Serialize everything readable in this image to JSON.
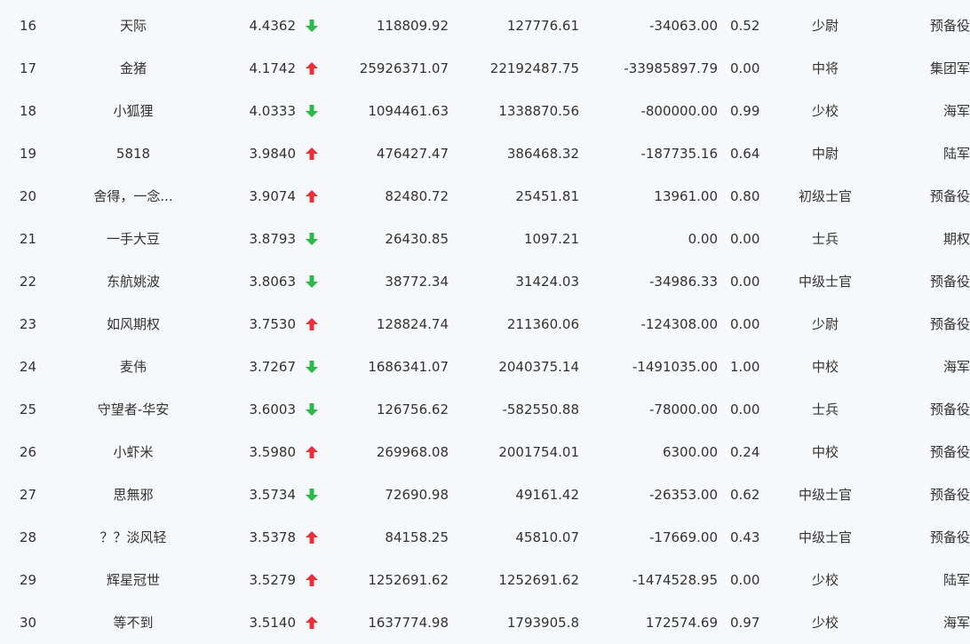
{
  "colors": {
    "up": "#e8303a",
    "down": "#2db84d",
    "text": "#333333",
    "background": "#f7f8fa"
  },
  "rows": [
    {
      "rank": "16",
      "name": "天际",
      "score": "4.4362",
      "trend": "down",
      "v1": "118809.92",
      "v2": "127776.61",
      "v3": "-34063.00",
      "ratio": "0.52",
      "title": "少尉",
      "branch": "预备役"
    },
    {
      "rank": "17",
      "name": "金猪",
      "score": "4.1742",
      "trend": "up",
      "v1": "25926371.07",
      "v2": "22192487.75",
      "v3": "-33985897.79",
      "ratio": "0.00",
      "title": "中将",
      "branch": "集团军"
    },
    {
      "rank": "18",
      "name": "小狐狸",
      "score": "4.0333",
      "trend": "down",
      "v1": "1094461.63",
      "v2": "1338870.56",
      "v3": "-800000.00",
      "ratio": "0.99",
      "title": "少校",
      "branch": "海军"
    },
    {
      "rank": "19",
      "name": "5818",
      "score": "3.9840",
      "trend": "up",
      "v1": "476427.47",
      "v2": "386468.32",
      "v3": "-187735.16",
      "ratio": "0.64",
      "title": "中尉",
      "branch": "陆军"
    },
    {
      "rank": "20",
      "name": "舍得，一念...",
      "score": "3.9074",
      "trend": "up",
      "v1": "82480.72",
      "v2": "25451.81",
      "v3": "13961.00",
      "ratio": "0.80",
      "title": "初级士官",
      "branch": "预备役"
    },
    {
      "rank": "21",
      "name": "一手大豆",
      "score": "3.8793",
      "trend": "down",
      "v1": "26430.85",
      "v2": "1097.21",
      "v3": "0.00",
      "ratio": "0.00",
      "title": "士兵",
      "branch": "期权"
    },
    {
      "rank": "22",
      "name": "东航姚波",
      "score": "3.8063",
      "trend": "down",
      "v1": "38772.34",
      "v2": "31424.03",
      "v3": "-34986.33",
      "ratio": "0.00",
      "title": "中级士官",
      "branch": "预备役"
    },
    {
      "rank": "23",
      "name": "如风期权",
      "score": "3.7530",
      "trend": "up",
      "v1": "128824.74",
      "v2": "211360.06",
      "v3": "-124308.00",
      "ratio": "0.00",
      "title": "少尉",
      "branch": "预备役"
    },
    {
      "rank": "24",
      "name": "麦伟",
      "score": "3.7267",
      "trend": "down",
      "v1": "1686341.07",
      "v2": "2040375.14",
      "v3": "-1491035.00",
      "ratio": "1.00",
      "title": "中校",
      "branch": "海军"
    },
    {
      "rank": "25",
      "name": "守望者-华安",
      "score": "3.6003",
      "trend": "down",
      "v1": "126756.62",
      "v2": "-582550.88",
      "v3": "-78000.00",
      "ratio": "0.00",
      "title": "士兵",
      "branch": "预备役"
    },
    {
      "rank": "26",
      "name": "小虾米",
      "score": "3.5980",
      "trend": "up",
      "v1": "269968.08",
      "v2": "2001754.01",
      "v3": "6300.00",
      "ratio": "0.24",
      "title": "中校",
      "branch": "预备役"
    },
    {
      "rank": "27",
      "name": "思無邪",
      "score": "3.5734",
      "trend": "down",
      "v1": "72690.98",
      "v2": "49161.42",
      "v3": "-26353.00",
      "ratio": "0.62",
      "title": "中级士官",
      "branch": "预备役"
    },
    {
      "rank": "28",
      "name": "？？淡风轻",
      "score": "3.5378",
      "trend": "up",
      "v1": "84158.25",
      "v2": "45810.07",
      "v3": "-17669.00",
      "ratio": "0.43",
      "title": "中级士官",
      "branch": "预备役"
    },
    {
      "rank": "29",
      "name": "辉星冠世",
      "score": "3.5279",
      "trend": "up",
      "v1": "1252691.62",
      "v2": "1252691.62",
      "v3": "-1474528.95",
      "ratio": "0.00",
      "title": "少校",
      "branch": "陆军"
    },
    {
      "rank": "30",
      "name": "等不到",
      "score": "3.5140",
      "trend": "up",
      "v1": "1637774.98",
      "v2": "1793905.8",
      "v3": "172574.69",
      "ratio": "0.97",
      "title": "少校",
      "branch": "海军"
    }
  ]
}
